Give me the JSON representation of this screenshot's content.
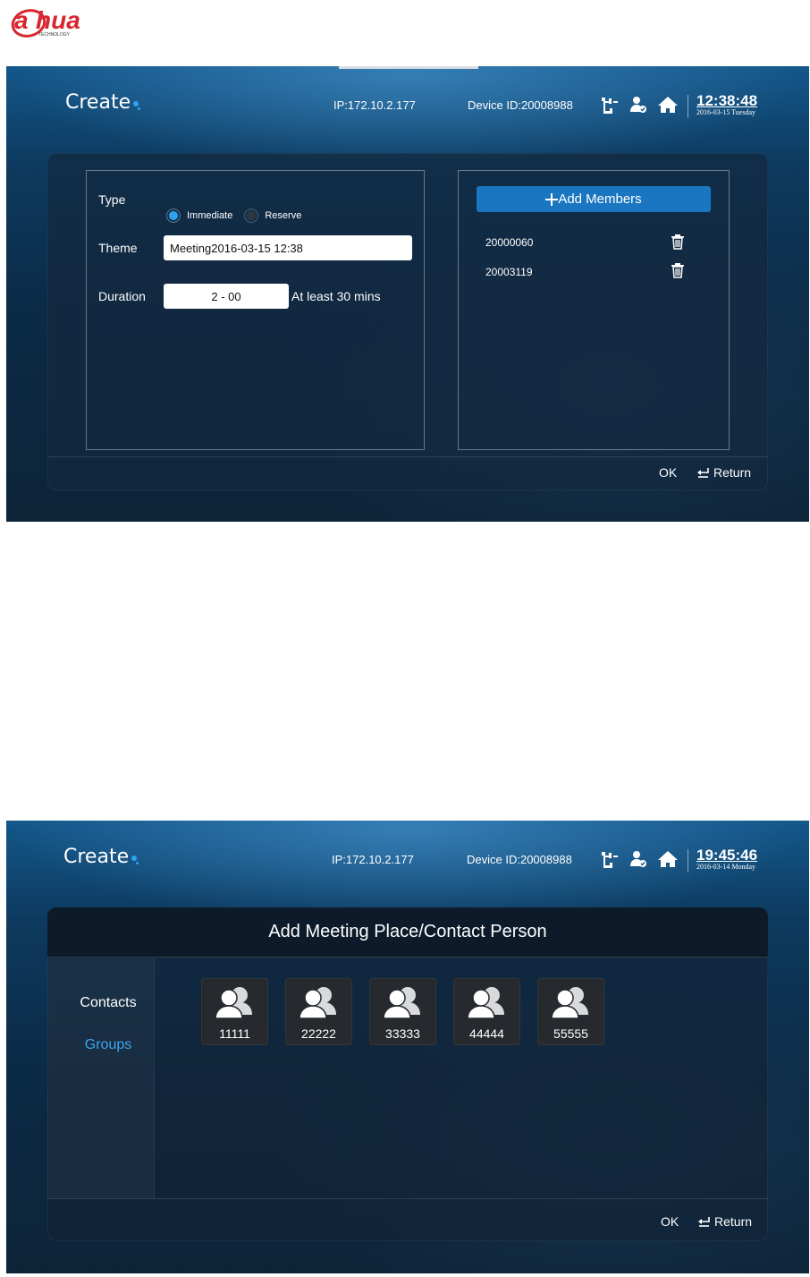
{
  "brand": {
    "logo_text": "alhua",
    "logo_subtext": "TECHNOLOGY"
  },
  "screen1": {
    "app_title": "Create",
    "ip": "IP:172.10.2.177",
    "device_id": "Device ID:20008988",
    "time": "12:38:48",
    "date": "2016-03-15 Tuesday",
    "form": {
      "type_label": "Type",
      "type_options": [
        "Immediate",
        "Reserve"
      ],
      "type_selected": "Immediate",
      "theme_label": "Theme",
      "theme_value": "Meeting2016-03-15 12:38",
      "duration_label": "Duration",
      "duration_value": "2 - 00",
      "duration_hint": "At least 30 mins"
    },
    "members": {
      "add_label": "Add Members",
      "list": [
        "20000060",
        "20003119"
      ]
    },
    "footer": {
      "ok": "OK",
      "return": "Return"
    }
  },
  "screen2": {
    "app_title": "Create",
    "ip": "IP:172.10.2.177",
    "device_id": "Device ID:20008988",
    "time": "19:45:46",
    "date": "2016-03-14 Monday",
    "dialog_title": "Add Meeting Place/Contact Person",
    "sidebar": [
      {
        "label": "Contacts",
        "active": false
      },
      {
        "label": "Groups",
        "active": true
      }
    ],
    "groups": [
      "11111",
      "22222",
      "33333",
      "44444",
      "55555"
    ],
    "footer": {
      "ok": "OK",
      "return": "Return"
    }
  },
  "colors": {
    "accent": "#2aa6f0",
    "button_blue": "#1a76c0",
    "active_sidebar": "#3aa6f0",
    "logo_red": "#d7262d"
  },
  "icons": [
    "network-icon",
    "user-status-icon",
    "home-icon",
    "trash-icon",
    "return-icon",
    "plus-icon",
    "group-icon"
  ]
}
